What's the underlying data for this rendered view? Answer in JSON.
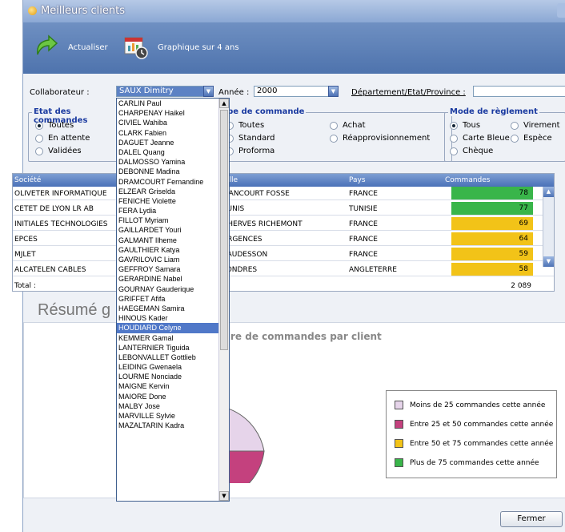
{
  "window": {
    "title": "Meilleurs clients"
  },
  "toolbar": {
    "refresh_label": "Actualiser",
    "chart_label": "Graphique sur 4 ans"
  },
  "filters": {
    "collaborateur_label": "Collaborateur :",
    "collaborateur_value": "SAUX Dimitry",
    "annee_label": "Année :",
    "annee_value": "2000",
    "departement_label": "Département/Etat/Province :",
    "departement_value": ""
  },
  "etat": {
    "legend": "Etat des commandes",
    "options": [
      "Toutes",
      "En attente",
      "Validées"
    ],
    "selected": "Toutes"
  },
  "type": {
    "legend": "Type de commande",
    "options": [
      "Toutes",
      "Standard",
      "Proforma",
      "Achat",
      "Réapprovisionnement"
    ]
  },
  "mode": {
    "legend": "Mode de règlement",
    "options": [
      "Tous",
      "Carte Bleue",
      "Chèque",
      "Virement",
      "Espèce"
    ],
    "selected": "Tous"
  },
  "grid": {
    "columns": [
      "Société",
      "Ville",
      "Pays",
      "Commandes"
    ],
    "rows": [
      {
        "societe": "OLIVETER INFORMATIQUE",
        "ville": "LIANCOURT FOSSE",
        "pays": "FRANCE",
        "commandes": "78",
        "color": "#39b54a"
      },
      {
        "societe": "CETET DE LYON LR AB",
        "ville": "TUNIS",
        "pays": "TUNISIE",
        "commandes": "77",
        "color": "#39b54a"
      },
      {
        "societe": "INITIALES TECHNOLOGIES",
        "ville": "CHERVES RICHEMONT",
        "pays": "FRANCE",
        "commandes": "69",
        "color": "#f2c318"
      },
      {
        "societe": "EPCES",
        "ville": "ARGENCES",
        "pays": "FRANCE",
        "commandes": "64",
        "color": "#f2c318"
      },
      {
        "societe": "MJLET",
        "ville": "VAUDESSON",
        "pays": "FRANCE",
        "commandes": "59",
        "color": "#f2c318"
      },
      {
        "societe": "ALCATELEN CABLES",
        "ville": "LONDRES",
        "pays": "ANGLETERRE",
        "commandes": "58",
        "color": "#f2c318"
      }
    ],
    "total_label": "Total :",
    "total_value": "2 089"
  },
  "resume": {
    "heading": "Résumé g",
    "chart_title": "re de commandes par client"
  },
  "legend": [
    {
      "label": "Moins de 25 commandes cette année",
      "color": "#e6d4ea"
    },
    {
      "label": "Entre 25 et 50 commandes cette année",
      "color": "#c4417e"
    },
    {
      "label": "Entre 50 et 75 commandes cette année",
      "color": "#f2c318"
    },
    {
      "label": "Plus de 75 commandes cette année",
      "color": "#39b54a"
    }
  ],
  "pie_colors": [
    "#e6d4ea",
    "#c4417e"
  ],
  "close_label": "Fermer",
  "dropdown": {
    "items": [
      "CARLIN Paul",
      "CHARPENAY Haikel",
      "CIVIEL Wahiba",
      "CLARK Fabien",
      "DAGUET Jeanne",
      "DALEL Quang",
      "DALMOSSO Yamina",
      "DEBONNE Madina",
      "DRAMCOURT Fernandine",
      "ELZEAR Griselda",
      "FENICHE Violette",
      "FERA Lydia",
      "FILLOT Myriam",
      "GAILLARDET Youri",
      "GALMANT Ilheme",
      "GAULTHIER Katya",
      "GAVRILOVIC Liam",
      "GEFFROY Samara",
      "GERARDINE Nabel",
      "GOURNAY Gauderique",
      "GRIFFET Afifa",
      "HAEGEMAN Samira",
      "HINOUS Kader",
      "HOUDIARD Celyne",
      "KEMMER Gamal",
      "LANTERNIER Tiguida",
      "LEBONVALLET Gottlieb",
      "LEIDING Gwenaela",
      "LOURME Nonciade",
      "MAIGNE Kervin",
      "MAIORE Done",
      "MALBY Jose",
      "MARVILLE Sylvie",
      "MAZALTARIN Kadra"
    ],
    "highlighted": "HOUDIARD Celyne"
  }
}
